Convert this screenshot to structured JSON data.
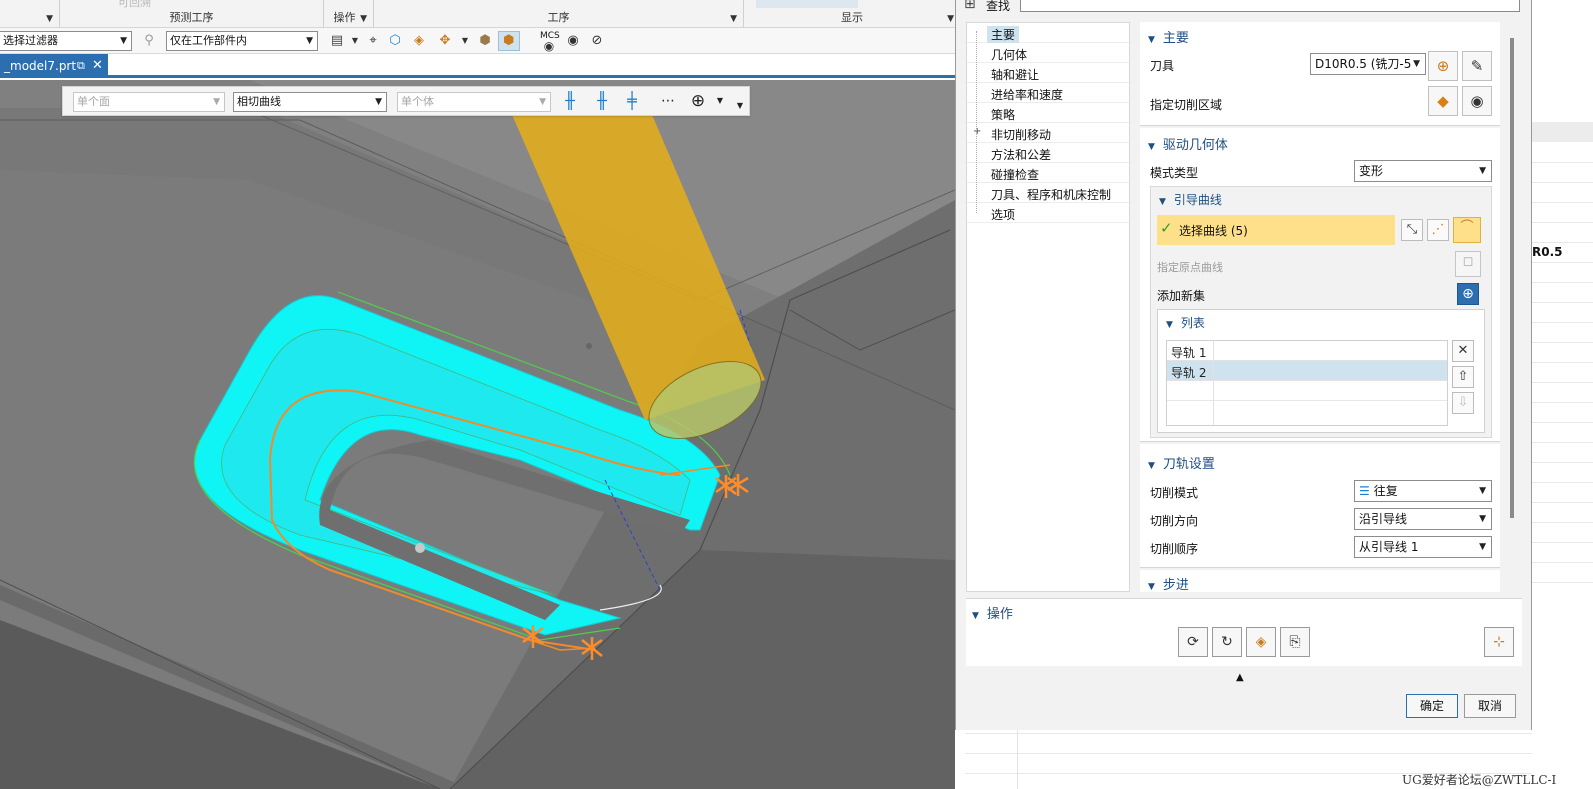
{
  "ribbon": {
    "groups": [
      {
        "label": "预测工序"
      },
      {
        "label": "操作"
      },
      {
        "label": "工序"
      },
      {
        "label": "显示"
      }
    ],
    "faded_text": "可回溯"
  },
  "selection_bar": {
    "type_filter": "选择过滤器",
    "scope_filter": "仅在工作部件内"
  },
  "file_tab": {
    "name": "_model7.prt"
  },
  "viewport_toolbar": {
    "face_rule": "单个面",
    "curve_rule": "相切曲线",
    "body_rule": "单个体"
  },
  "dialog": {
    "find_label": "查找",
    "find_value": "",
    "tree": [
      {
        "label": "主要",
        "selected": true
      },
      {
        "label": "几何体"
      },
      {
        "label": "轴和避让"
      },
      {
        "label": "进给率和速度"
      },
      {
        "label": "策略"
      },
      {
        "label": "非切削移动",
        "expandable": true
      },
      {
        "label": "方法和公差"
      },
      {
        "label": "碰撞检查"
      },
      {
        "label": "刀具、程序和机床控制"
      },
      {
        "label": "选项"
      }
    ],
    "main": {
      "title": "主要",
      "tool_label": "刀具",
      "tool_value": "D10R0.5 (铣刀-5",
      "cut_area_label": "指定切削区域"
    },
    "drive": {
      "title": "驱动几何体",
      "pattern_label": "模式类型",
      "pattern_value": "变形",
      "guide_title": "引导曲线",
      "select_curve": "选择曲线 (5)",
      "origin_curve": "指定原点曲线",
      "add_set": "添加新集",
      "list_title": "列表",
      "list_items": [
        "导轨 1",
        "导轨 2"
      ]
    },
    "toolpath": {
      "title": "刀轨设置",
      "cut_pattern_label": "切削模式",
      "cut_pattern_value": "往复",
      "cut_direction_label": "切削方向",
      "cut_direction_value": "沿引导线",
      "cut_order_label": "切削顺序",
      "cut_order_value": "从引导线 1"
    },
    "stepover": {
      "title": "步进"
    },
    "operations": {
      "title": "操作"
    },
    "ok_label": "确定",
    "cancel_label": "取消"
  },
  "right_panel": {
    "tool_fragment": "R0.5"
  },
  "watermark": "UG爱好者论坛@ZWTLLC-I",
  "colors": {
    "toolpath": "#00f0f0",
    "tool": "#e2ac1a",
    "accent": "#2b6fb0",
    "highlight": "#ffe08a",
    "marker": "#ff8c2a"
  }
}
